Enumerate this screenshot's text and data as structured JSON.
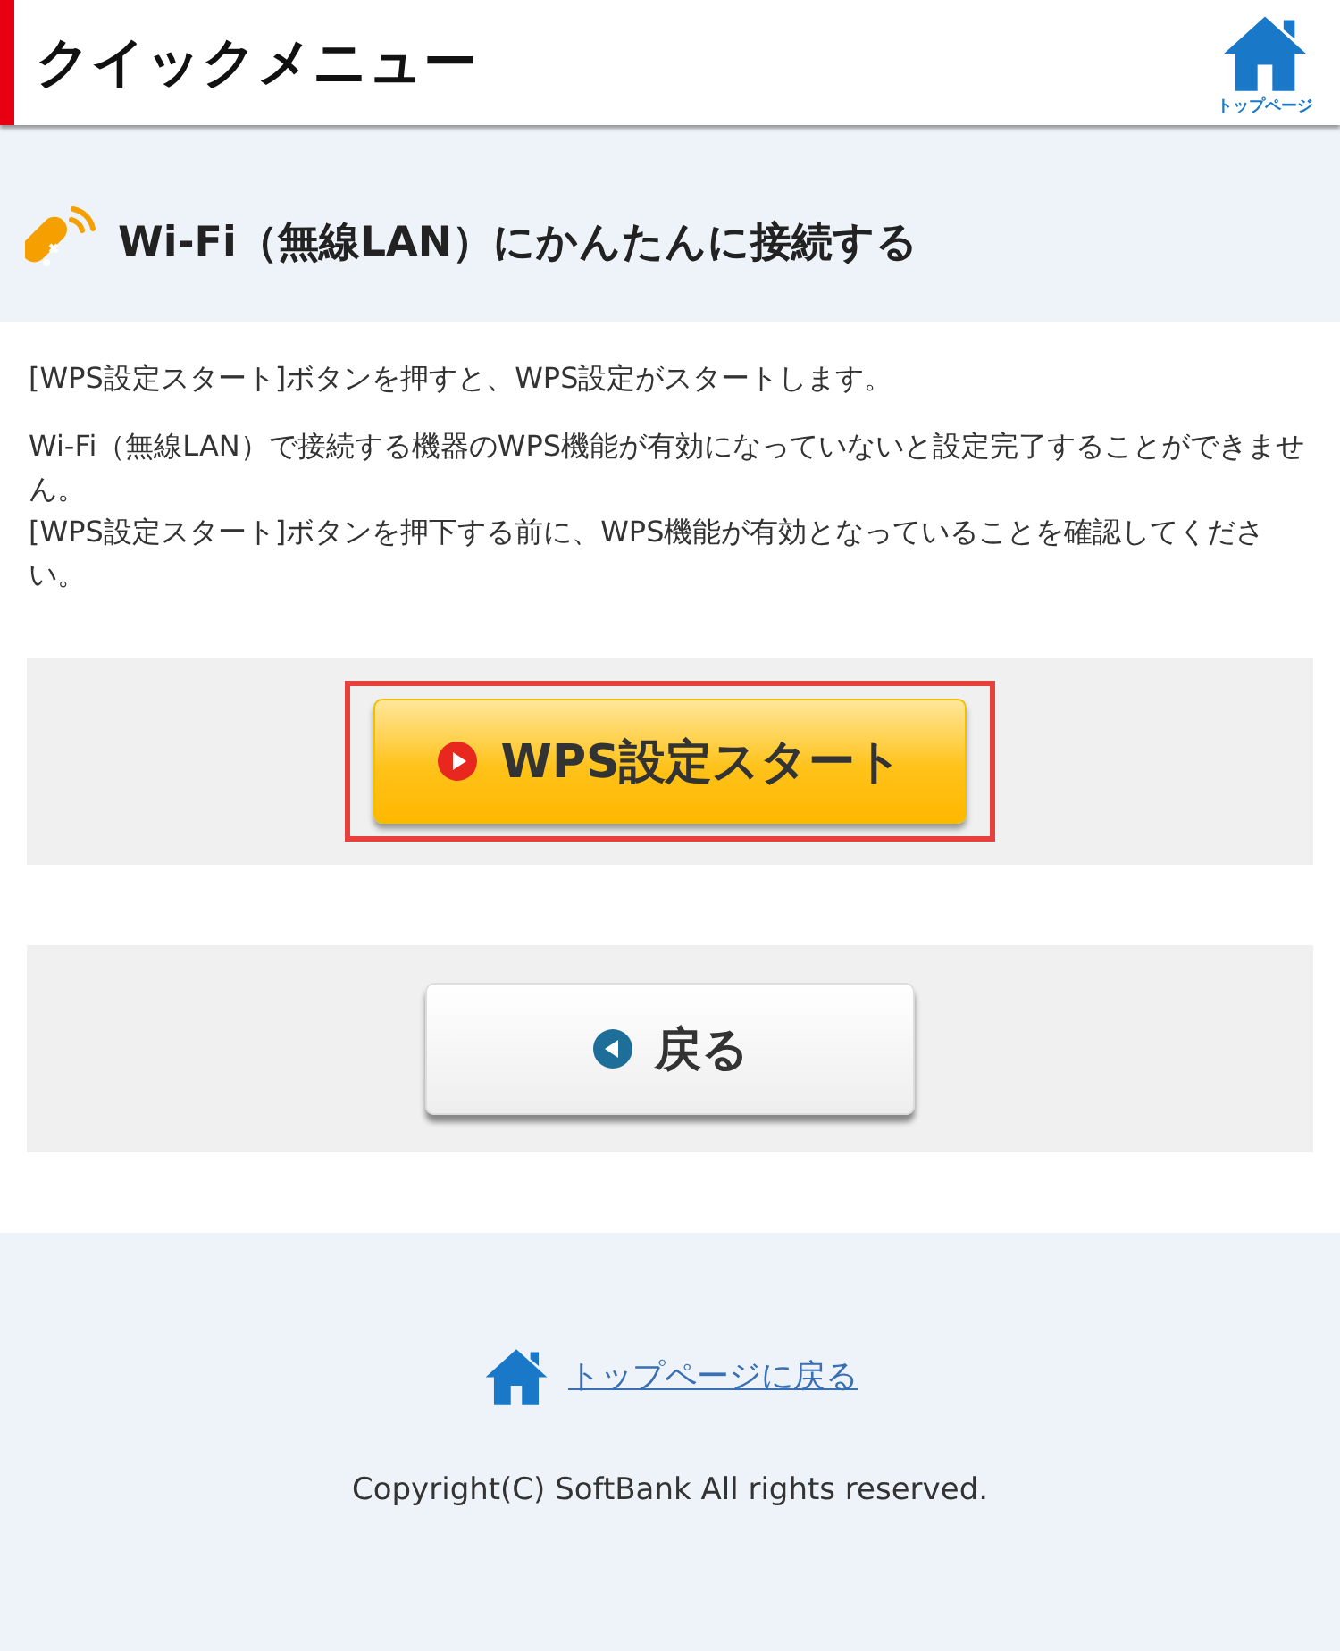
{
  "header": {
    "title": "クイックメニュー",
    "home_label": "トップページ"
  },
  "section": {
    "title": "Wi-Fi（無線LAN）にかんたんに接続する"
  },
  "paragraphs": [
    "[WPS設定スタート]ボタンを押すと、WPS設定がスタートします。",
    "Wi-Fi（無線LAN）で接続する機器のWPS機能が有効になっていないと設定完了することができません。\n[WPS設定スタート]ボタンを押下する前に、WPS機能が有効となっていることを確認してください。"
  ],
  "buttons": [
    {
      "kind": "start",
      "label": "WPS設定スタート",
      "highlighted": true
    },
    {
      "kind": "back",
      "label": "戻る",
      "highlighted": false
    }
  ],
  "footer": {
    "link": "トップページに戻る",
    "copyright": "Copyright(C) SoftBank All rights reserved."
  }
}
